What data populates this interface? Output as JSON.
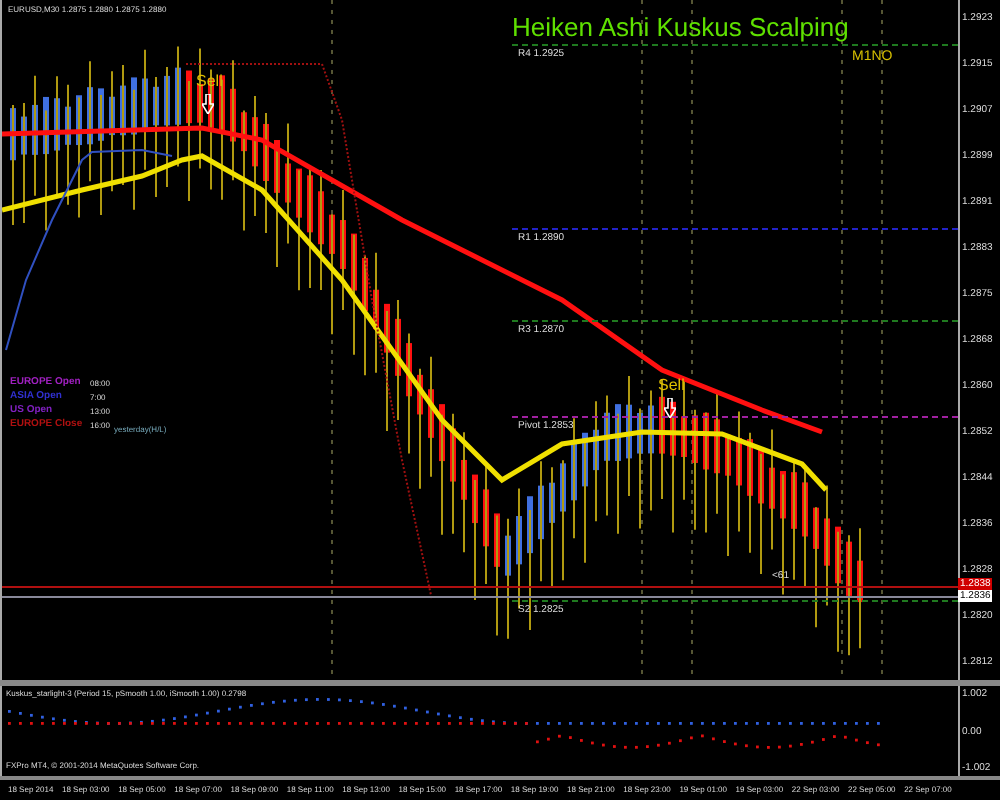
{
  "chart": {
    "symbol_info": "EURUSD,M30 1.2875 1.2880 1.2875 1.2880",
    "title": "Heiken Ashi Kuskus Scalping",
    "timeframe_label": "M1NO",
    "signals": [
      {
        "label": "Sell",
        "kind": "sell"
      },
      {
        "label": "Sell",
        "kind": "sell"
      }
    ],
    "levels": [
      {
        "label": "R4 1.2925",
        "color": "#1f7a1f"
      },
      {
        "label": "R1 1.2890",
        "color": "#2323c8"
      },
      {
        "label": "R3 1.2870",
        "color": "#1f7a1f"
      },
      {
        "label": "Pivot 1.2853",
        "color": "#a020a0"
      },
      {
        "label": "S2 1.2825",
        "color": "#1f7a1f"
      }
    ],
    "legend": [
      {
        "label": "EUROPE Open",
        "time": "08:00",
        "color": "#a020c0"
      },
      {
        "label": "ASIA Open",
        "time": "7:00",
        "color": "#3030d0"
      },
      {
        "label": "US Open",
        "time": "13:00",
        "color": "#8020c0"
      },
      {
        "label": "EUROPE Close",
        "time": "16:00",
        "color": "#b01010"
      }
    ],
    "yesterday_label": "yesterday(H/L)",
    "price_marker": "<61",
    "price_axis": [
      "1.2923",
      "1.2915",
      "1.2907",
      "1.2899",
      "1.2891",
      "1.2883",
      "1.2875",
      "1.2868",
      "1.2860",
      "1.2852",
      "1.2844",
      "1.2836",
      "1.2828",
      "1.2820",
      "1.2812"
    ],
    "current_prices": [
      "1.2838",
      "1.2836"
    ]
  },
  "indicator": {
    "label": "Kuskus_starlight-3 (Period 15, pSmooth 1.00, iSmooth 1.00) 0.2798",
    "axis": [
      "1.002",
      "0.00",
      "-1.002"
    ],
    "copyright": "FXPro MT4, © 2001-2014 MetaQuotes Software Corp."
  },
  "time_axis": [
    "18 Sep 2014",
    "18 Sep 03:00",
    "18 Sep 05:00",
    "18 Sep 07:00",
    "18 Sep 09:00",
    "18 Sep 11:00",
    "18 Sep 13:00",
    "18 Sep 15:00",
    "18 Sep 17:00",
    "18 Sep 19:00",
    "18 Sep 21:00",
    "18 Sep 23:00",
    "19 Sep 01:00",
    "19 Sep 03:00",
    "22 Sep 03:00",
    "22 Sep 05:00",
    "22 Sep 07:00"
  ]
}
